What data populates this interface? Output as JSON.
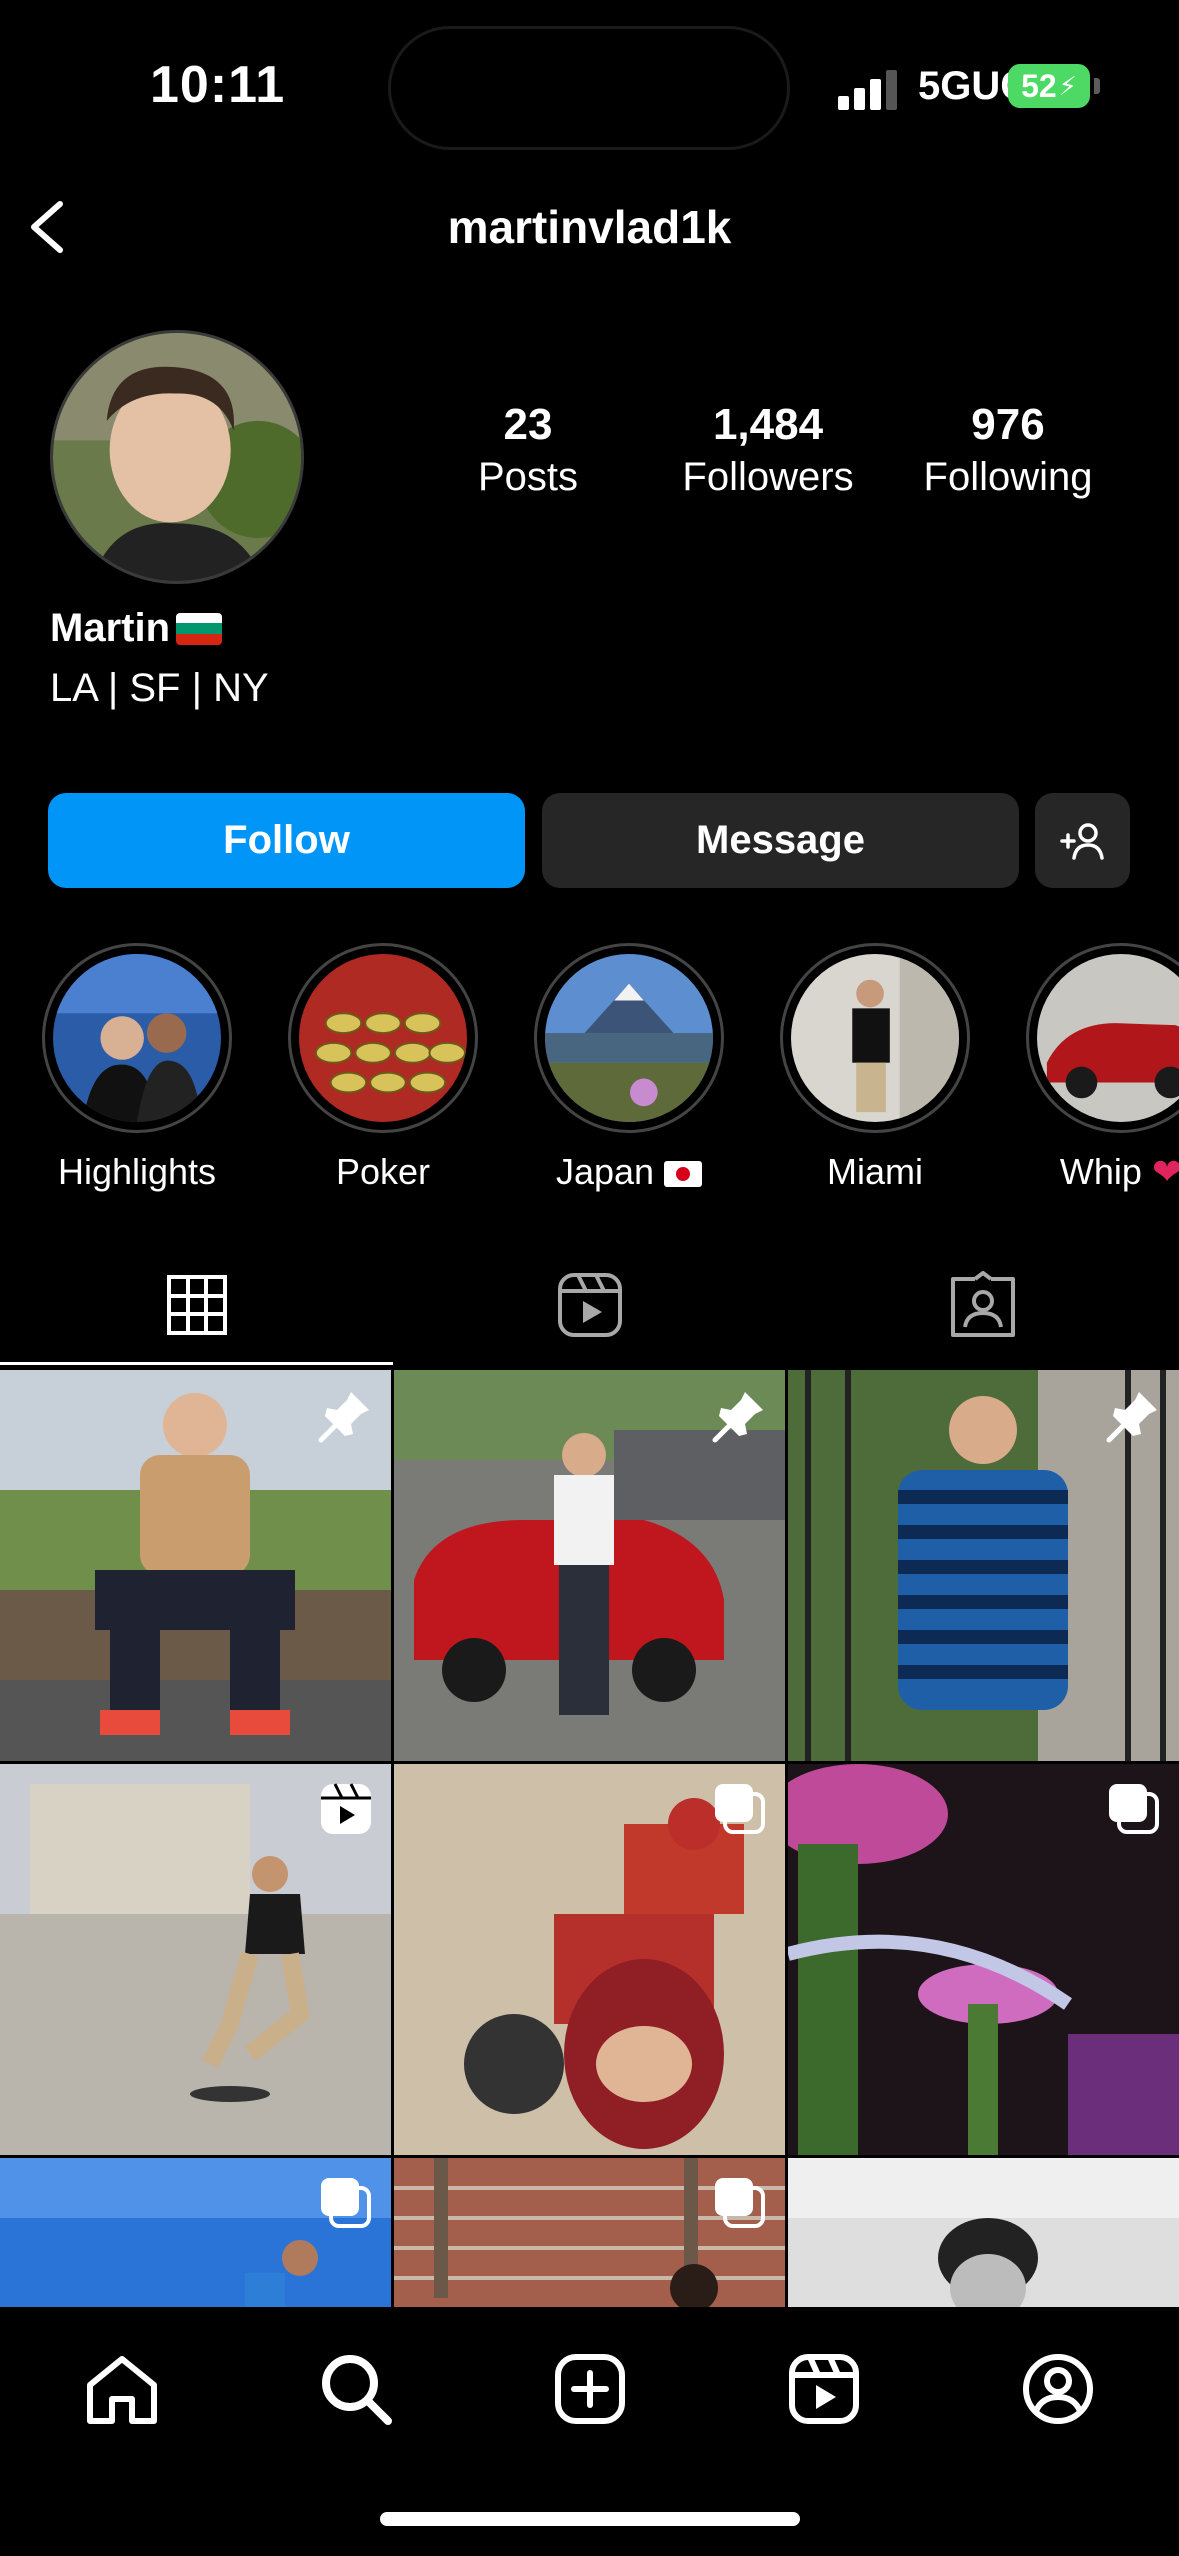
{
  "status_bar": {
    "time": "10:11",
    "network": "5GUC",
    "battery": "52"
  },
  "header": {
    "username": "martinvlad1k"
  },
  "profile": {
    "name": "Martin",
    "bio": "LA | SF | NY",
    "stats": [
      {
        "value": "23",
        "label": "Posts"
      },
      {
        "value": "1,484",
        "label": "Followers"
      },
      {
        "value": "976",
        "label": "Following"
      }
    ]
  },
  "actions": {
    "follow": "Follow",
    "message": "Message"
  },
  "highlights": [
    {
      "label": "Highlights"
    },
    {
      "label": "Poker"
    },
    {
      "label": "Japan"
    },
    {
      "label": "Miami"
    },
    {
      "label": "Whip"
    }
  ],
  "tabs": [
    "grid-posts",
    "reels",
    "tagged"
  ],
  "grid": {
    "posts": [
      {
        "badge": "pin-icon"
      },
      {
        "badge": "pin-icon"
      },
      {
        "badge": "pin-icon"
      },
      {
        "badge": "reel-icon"
      },
      {
        "badge": "carousel-icon"
      },
      {
        "badge": "carousel-icon"
      },
      {
        "badge": "carousel-icon"
      },
      {
        "badge": "carousel-icon"
      },
      {
        "badge": ""
      }
    ]
  },
  "bottom_nav": [
    "home-icon",
    "search-icon",
    "create-icon",
    "reels-icon",
    "profile-icon"
  ],
  "colors": {
    "accent": "#0095f6",
    "button_secondary": "#262626",
    "background": "#000000"
  }
}
